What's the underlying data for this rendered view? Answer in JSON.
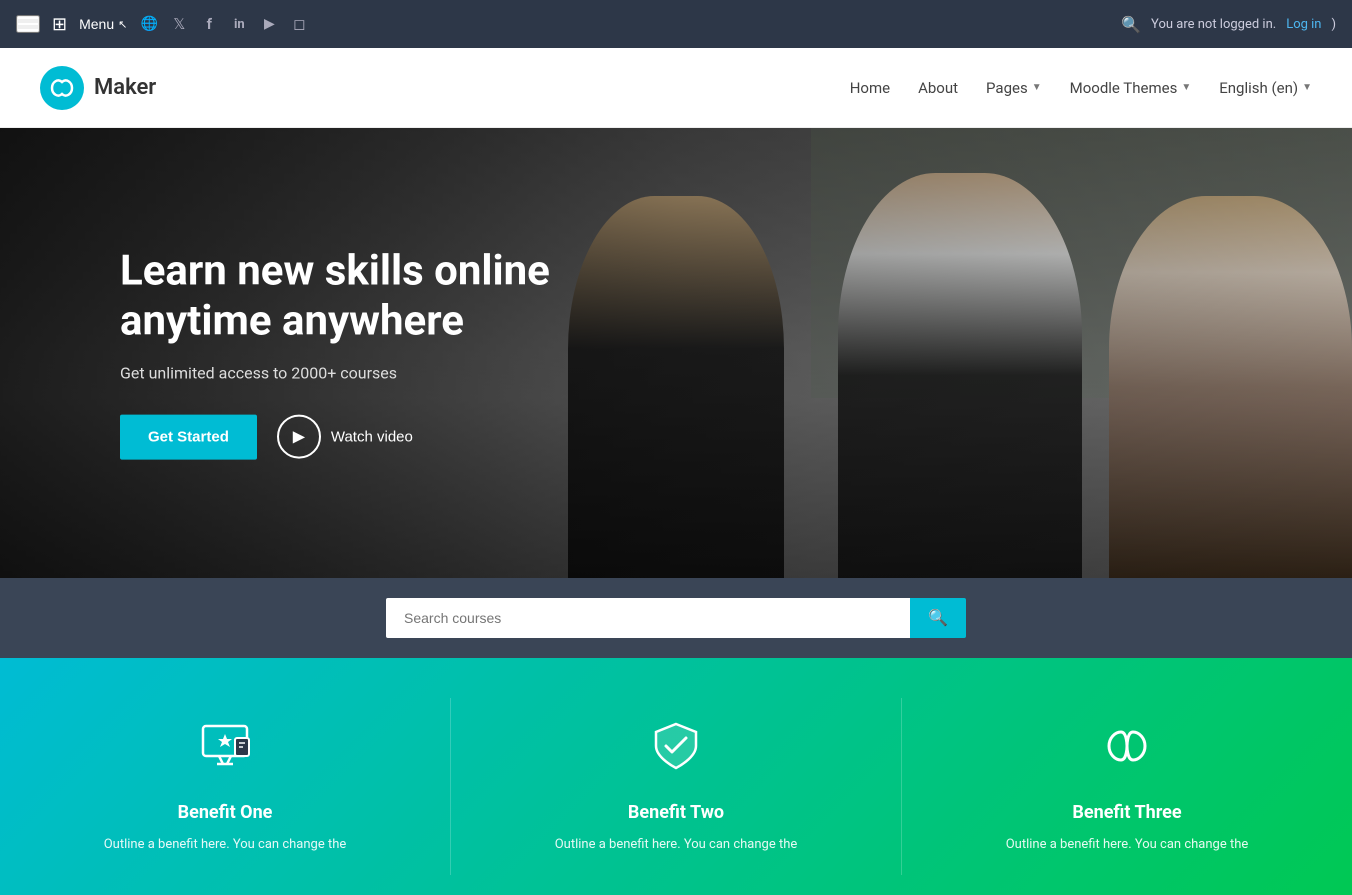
{
  "topbar": {
    "menu_label": "Menu",
    "not_logged_in": "You are not logged in.",
    "log_in_label": "Log in",
    "social_icons": [
      {
        "name": "globe-icon",
        "symbol": "🌐"
      },
      {
        "name": "twitter-icon",
        "symbol": "🐦"
      },
      {
        "name": "facebook-icon",
        "symbol": "f"
      },
      {
        "name": "linkedin-icon",
        "symbol": "in"
      },
      {
        "name": "youtube-icon",
        "symbol": "▶"
      },
      {
        "name": "instagram-icon",
        "symbol": "📷"
      }
    ]
  },
  "nav": {
    "logo_text": "Maker",
    "links": [
      {
        "label": "Home",
        "has_dropdown": false
      },
      {
        "label": "About",
        "has_dropdown": false
      },
      {
        "label": "Pages",
        "has_dropdown": true
      },
      {
        "label": "Moodle Themes",
        "has_dropdown": true
      },
      {
        "label": "English (en)",
        "has_dropdown": true
      }
    ]
  },
  "hero": {
    "title": "Learn new skills online anytime anywhere",
    "subtitle": "Get unlimited access to 2000+ courses",
    "cta_primary": "Get Started",
    "cta_watch": "Watch video"
  },
  "search": {
    "placeholder": "Search courses"
  },
  "benefits": [
    {
      "icon": "monitor-star-icon",
      "title": "Benefit One",
      "text": "Outline a benefit here. You can change the"
    },
    {
      "icon": "shield-check-icon",
      "title": "Benefit Two",
      "text": "Outline a benefit here. You can change the"
    },
    {
      "icon": "infinity-icon",
      "title": "Benefit Three",
      "text": "Outline a benefit here. You can change the"
    }
  ]
}
